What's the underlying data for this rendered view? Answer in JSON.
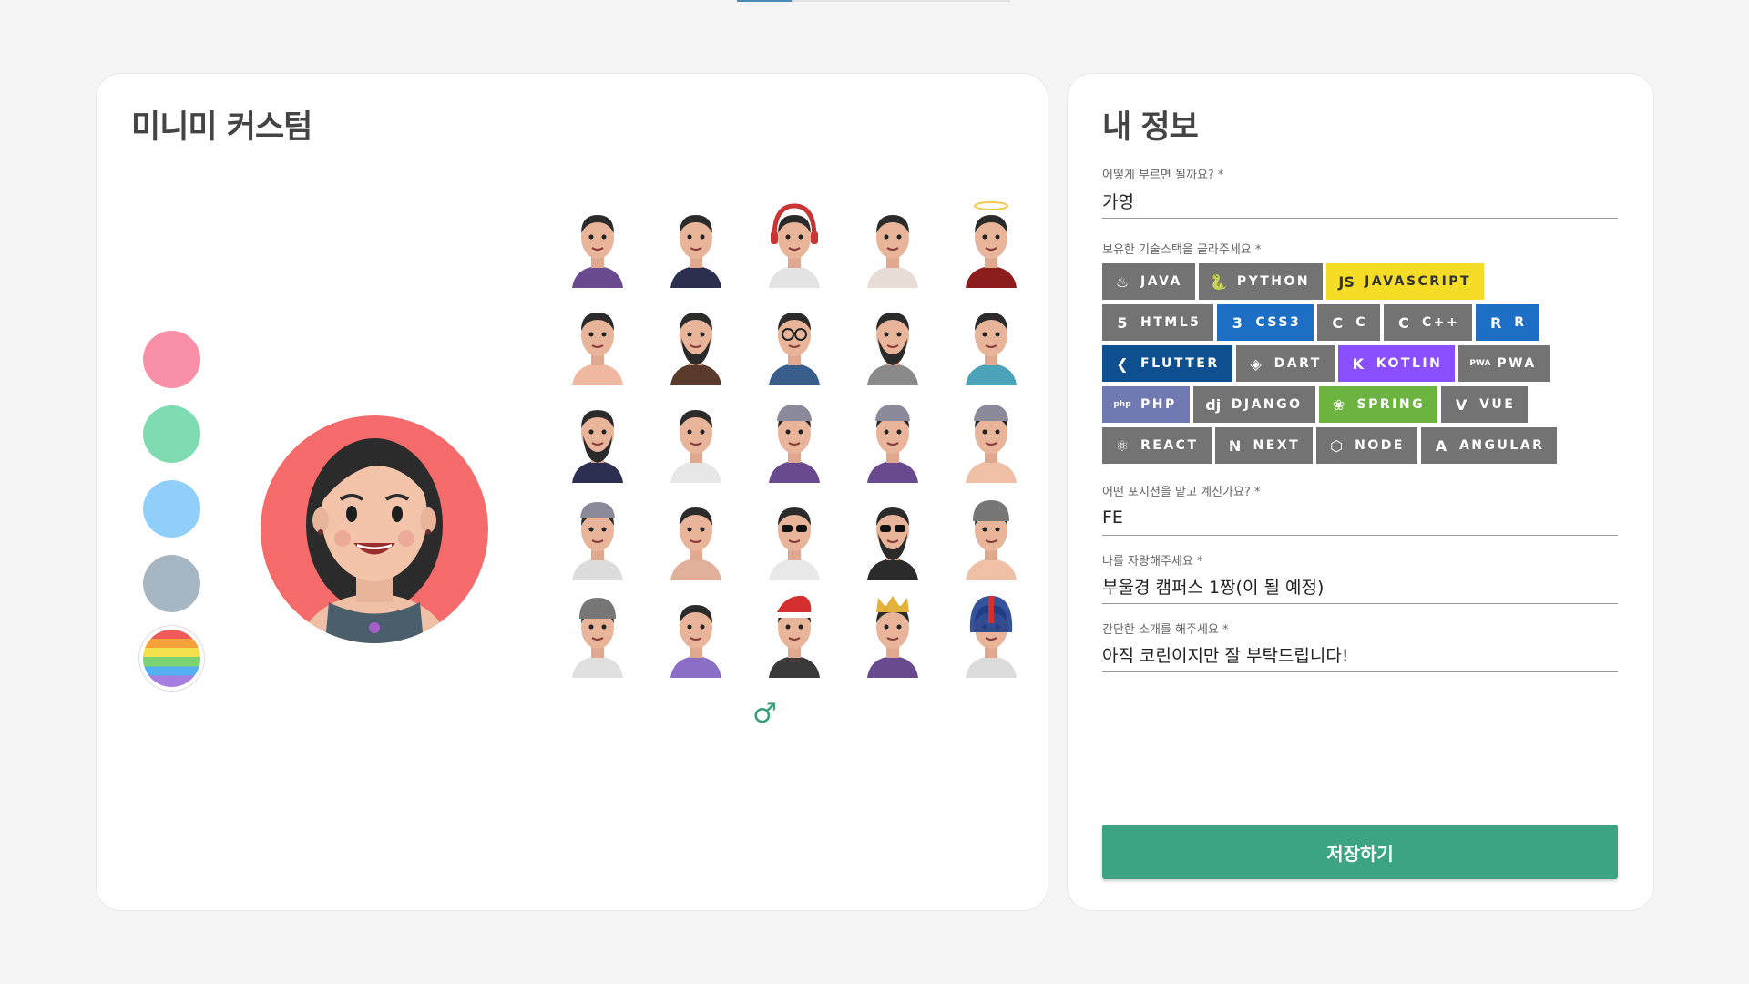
{
  "left": {
    "title": "미니미 커스텀",
    "swatches": [
      {
        "name": "pink",
        "color": "#f78fa7"
      },
      {
        "name": "green",
        "color": "#7fdcb2"
      },
      {
        "name": "blue",
        "color": "#90cffa"
      },
      {
        "name": "gray",
        "color": "#a7b6c3"
      },
      {
        "name": "rainbow",
        "color": "rainbow"
      }
    ],
    "selected_bg_color": "#f56b6b",
    "gender_icon": "♂",
    "avatar_count": 25
  },
  "right": {
    "title": "내 정보",
    "name_label": "어떻게 부르면 될까요? *",
    "name_value": "가영",
    "stack_label": "보유한 기술스택을 골라주세요 *",
    "stacks": [
      [
        {
          "label": "JAVA",
          "icon": "♨",
          "style": "gray"
        },
        {
          "label": "PYTHON",
          "icon": "🐍",
          "style": "gray"
        },
        {
          "label": "JAVASCRIPT",
          "icon": "JS",
          "style": "js"
        }
      ],
      [
        {
          "label": "HTML5",
          "icon": "5",
          "style": "gray"
        },
        {
          "label": "CSS3",
          "icon": "3",
          "style": "blue"
        },
        {
          "label": "C",
          "icon": "C",
          "style": "gray"
        },
        {
          "label": "C++",
          "icon": "C",
          "style": "gray"
        },
        {
          "label": "R",
          "icon": "R",
          "style": "blue"
        }
      ],
      [
        {
          "label": "FLUTTER",
          "icon": "❮",
          "style": "flutter"
        },
        {
          "label": "DART",
          "icon": "◈",
          "style": "gray"
        },
        {
          "label": "KOTLIN",
          "icon": "K",
          "style": "kotlin"
        },
        {
          "label": "PWA",
          "icon": "PWA",
          "style": "gray"
        }
      ],
      [
        {
          "label": "PHP",
          "icon": "php",
          "style": "php"
        },
        {
          "label": "DJANGO",
          "icon": "dj",
          "style": "gray"
        },
        {
          "label": "SPRING",
          "icon": "❀",
          "style": "spring"
        },
        {
          "label": "VUE",
          "icon": "V",
          "style": "gray"
        }
      ],
      [
        {
          "label": "REACT",
          "icon": "⚛",
          "style": "gray"
        },
        {
          "label": "NEXT",
          "icon": "N",
          "style": "gray"
        },
        {
          "label": "NODE",
          "icon": "⬡",
          "style": "gray"
        },
        {
          "label": "ANGULAR",
          "icon": "A",
          "style": "gray"
        }
      ]
    ],
    "position_label": "어떤 포지션을 맡고 계신가요? *",
    "position_value": "FE",
    "pride_label": "나를 자랑해주세요 *",
    "pride_value": "부울경 캠퍼스 1짱(이 될 예정)",
    "intro_label": "간단한 소개를 해주세요 *",
    "intro_value": "아직 코린이지만 잘 부탁드립니다!",
    "save_label": "저장하기"
  },
  "colors": {
    "accent": "#3ca483",
    "tab_active": "#4a8bb5"
  }
}
